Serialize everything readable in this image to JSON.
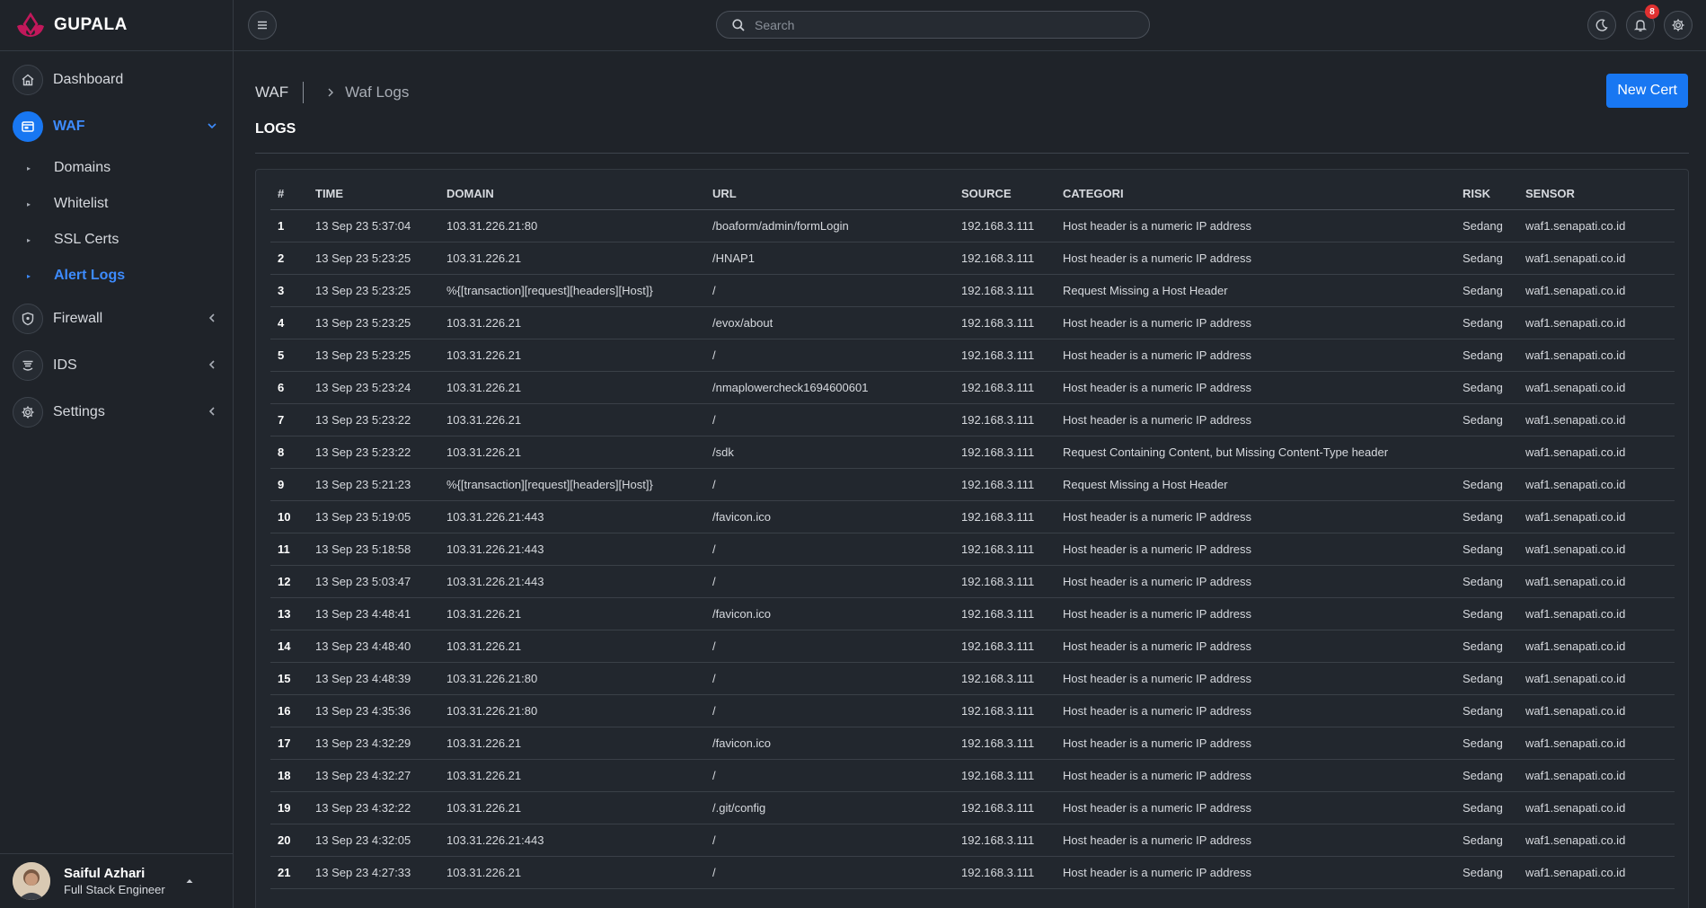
{
  "app": {
    "name": "GUPALA",
    "brand_color": "#c2185b"
  },
  "header": {
    "search_placeholder": "Search",
    "notification_count": "8"
  },
  "sidebar": {
    "items": [
      {
        "label": "Dashboard",
        "icon": "home-icon"
      },
      {
        "label": "WAF",
        "icon": "waf-icon",
        "active": true,
        "expanded": true
      },
      {
        "label": "Firewall",
        "icon": "shield-icon"
      },
      {
        "label": "IDS",
        "icon": "ids-icon"
      },
      {
        "label": "Settings",
        "icon": "gear-icon"
      }
    ],
    "waf_sub": [
      "Domains",
      "Whitelist",
      "SSL Certs",
      "Alert Logs"
    ]
  },
  "profile": {
    "name": "Saiful Azhari",
    "role": "Full Stack Engineer"
  },
  "breadcrumb": {
    "root": "WAF",
    "leaf": "Waf Logs"
  },
  "page": {
    "title": "LOGS",
    "new_button": "New Cert"
  },
  "table": {
    "columns": [
      "#",
      "TIME",
      "DOMAIN",
      "URL",
      "SOURCE",
      "CATEGORI",
      "RISK",
      "SENSOR"
    ],
    "rows": [
      [
        "1",
        "13 Sep 23 5:37:04",
        "103.31.226.21:80",
        "/boaform/admin/formLogin",
        "192.168.3.111",
        "Host header is a numeric IP address",
        "Sedang",
        "waf1.senapati.co.id"
      ],
      [
        "2",
        "13 Sep 23 5:23:25",
        "103.31.226.21",
        "/HNAP1",
        "192.168.3.111",
        "Host header is a numeric IP address",
        "Sedang",
        "waf1.senapati.co.id"
      ],
      [
        "3",
        "13 Sep 23 5:23:25",
        "%{[transaction][request][headers][Host]}",
        "/",
        "192.168.3.111",
        "Request Missing a Host Header",
        "Sedang",
        "waf1.senapati.co.id"
      ],
      [
        "4",
        "13 Sep 23 5:23:25",
        "103.31.226.21",
        "/evox/about",
        "192.168.3.111",
        "Host header is a numeric IP address",
        "Sedang",
        "waf1.senapati.co.id"
      ],
      [
        "5",
        "13 Sep 23 5:23:25",
        "103.31.226.21",
        "/",
        "192.168.3.111",
        "Host header is a numeric IP address",
        "Sedang",
        "waf1.senapati.co.id"
      ],
      [
        "6",
        "13 Sep 23 5:23:24",
        "103.31.226.21",
        "/nmaplowercheck1694600601",
        "192.168.3.111",
        "Host header is a numeric IP address",
        "Sedang",
        "waf1.senapati.co.id"
      ],
      [
        "7",
        "13 Sep 23 5:23:22",
        "103.31.226.21",
        "/",
        "192.168.3.111",
        "Host header is a numeric IP address",
        "Sedang",
        "waf1.senapati.co.id"
      ],
      [
        "8",
        "13 Sep 23 5:23:22",
        "103.31.226.21",
        "/sdk",
        "192.168.3.111",
        "Request Containing Content, but Missing Content-Type header",
        "",
        "waf1.senapati.co.id"
      ],
      [
        "9",
        "13 Sep 23 5:21:23",
        "%{[transaction][request][headers][Host]}",
        "/",
        "192.168.3.111",
        "Request Missing a Host Header",
        "Sedang",
        "waf1.senapati.co.id"
      ],
      [
        "10",
        "13 Sep 23 5:19:05",
        "103.31.226.21:443",
        "/favicon.ico",
        "192.168.3.111",
        "Host header is a numeric IP address",
        "Sedang",
        "waf1.senapati.co.id"
      ],
      [
        "11",
        "13 Sep 23 5:18:58",
        "103.31.226.21:443",
        "/",
        "192.168.3.111",
        "Host header is a numeric IP address",
        "Sedang",
        "waf1.senapati.co.id"
      ],
      [
        "12",
        "13 Sep 23 5:03:47",
        "103.31.226.21:443",
        "/",
        "192.168.3.111",
        "Host header is a numeric IP address",
        "Sedang",
        "waf1.senapati.co.id"
      ],
      [
        "13",
        "13 Sep 23 4:48:41",
        "103.31.226.21",
        "/favicon.ico",
        "192.168.3.111",
        "Host header is a numeric IP address",
        "Sedang",
        "waf1.senapati.co.id"
      ],
      [
        "14",
        "13 Sep 23 4:48:40",
        "103.31.226.21",
        "/",
        "192.168.3.111",
        "Host header is a numeric IP address",
        "Sedang",
        "waf1.senapati.co.id"
      ],
      [
        "15",
        "13 Sep 23 4:48:39",
        "103.31.226.21:80",
        "/",
        "192.168.3.111",
        "Host header is a numeric IP address",
        "Sedang",
        "waf1.senapati.co.id"
      ],
      [
        "16",
        "13 Sep 23 4:35:36",
        "103.31.226.21:80",
        "/",
        "192.168.3.111",
        "Host header is a numeric IP address",
        "Sedang",
        "waf1.senapati.co.id"
      ],
      [
        "17",
        "13 Sep 23 4:32:29",
        "103.31.226.21",
        "/favicon.ico",
        "192.168.3.111",
        "Host header is a numeric IP address",
        "Sedang",
        "waf1.senapati.co.id"
      ],
      [
        "18",
        "13 Sep 23 4:32:27",
        "103.31.226.21",
        "/",
        "192.168.3.111",
        "Host header is a numeric IP address",
        "Sedang",
        "waf1.senapati.co.id"
      ],
      [
        "19",
        "13 Sep 23 4:32:22",
        "103.31.226.21",
        "/.git/config",
        "192.168.3.111",
        "Host header is a numeric IP address",
        "Sedang",
        "waf1.senapati.co.id"
      ],
      [
        "20",
        "13 Sep 23 4:32:05",
        "103.31.226.21:443",
        "/",
        "192.168.3.111",
        "Host header is a numeric IP address",
        "Sedang",
        "waf1.senapati.co.id"
      ],
      [
        "21",
        "13 Sep 23 4:27:33",
        "103.31.226.21",
        "/",
        "192.168.3.111",
        "Host header is a numeric IP address",
        "Sedang",
        "waf1.senapati.co.id"
      ]
    ]
  }
}
